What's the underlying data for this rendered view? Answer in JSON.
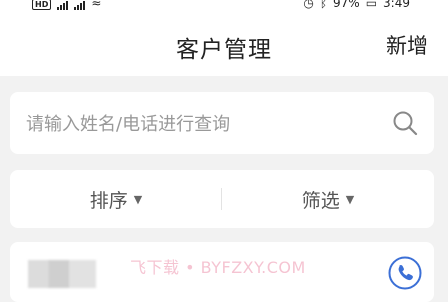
{
  "status_bar": {
    "left_badge": "HD",
    "right_text": "97%",
    "time": "3:49"
  },
  "header": {
    "title": "客户管理",
    "add_label": "新增"
  },
  "search": {
    "placeholder": "请输入姓名/电话进行查询",
    "value": ""
  },
  "filters": {
    "sort_label": "排序",
    "filter_label": "筛选"
  },
  "list": {
    "watermark": "飞下载 • BYFZXY.COM"
  },
  "colors": {
    "accent": "#3b6fd6",
    "background": "#f2f2f2"
  }
}
